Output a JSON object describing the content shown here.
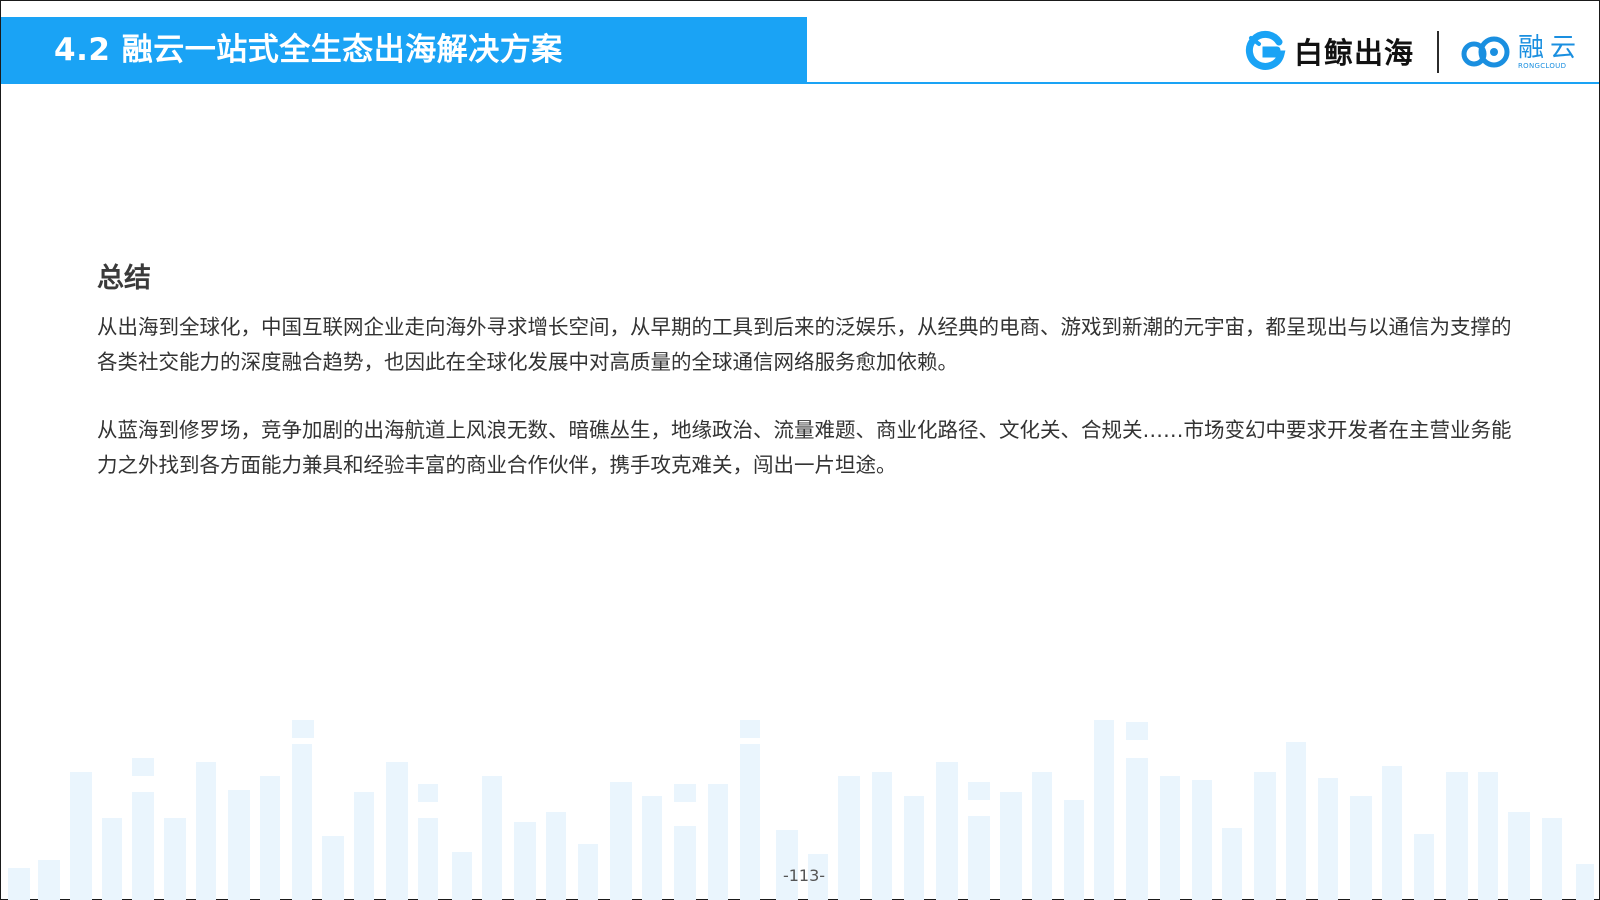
{
  "header": {
    "title": "4.2 融云一站式全生态出海解决方案",
    "brand_color": "#1aa3f5",
    "logos": {
      "baijing": {
        "text": "白鲸出海",
        "icon": "baijing-logo-icon"
      },
      "rongcloud": {
        "text": "融云",
        "subtext": "RONGCLOUD",
        "icon": "rongcloud-logo-icon"
      }
    }
  },
  "content": {
    "heading": "总结",
    "paragraphs": [
      "从出海到全球化，中国互联网企业走向海外寻求增长空间，从早期的工具到后来的泛娱乐，从经典的电商、游戏到新潮的元宇宙，都呈现出与以通信为支撑的各类社交能力的深度融合趋势，也因此在全球化发展中对高质量的全球通信网络服务愈加依赖。",
      "从蓝海到修罗场，竞争加剧的出海航道上风浪无数、暗礁丛生，地缘政治、流量难题、商业化路径、文化关、合规关……市场变幻中要求开发者在主营业务能力之外找到各方面能力兼具和经验丰富的商业合作伙伴，携手攻克难关，闯出一片坦途。"
    ]
  },
  "decoration": {
    "bar_color": "#eaf5fd"
  },
  "footer": {
    "page_number": "-113-"
  }
}
